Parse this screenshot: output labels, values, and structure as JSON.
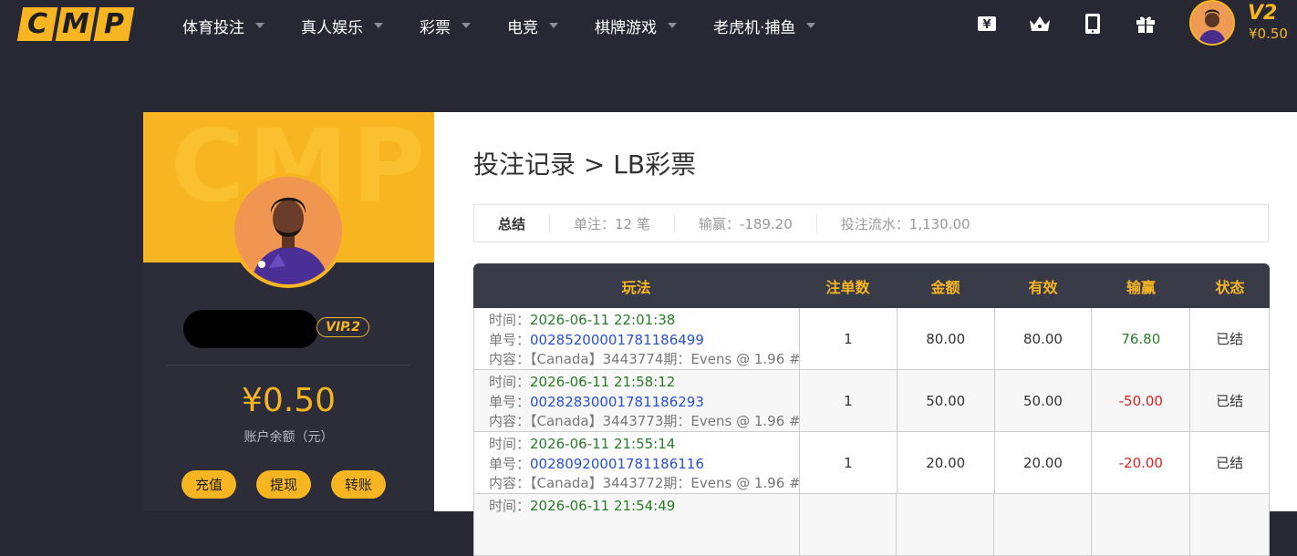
{
  "logo": {
    "letters": [
      "C",
      "M",
      "P"
    ]
  },
  "nav": [
    {
      "label": "体育投注"
    },
    {
      "label": "真人娱乐"
    },
    {
      "label": "彩票"
    },
    {
      "label": "电竞"
    },
    {
      "label": "棋牌游戏"
    },
    {
      "label": "老虎机·捕鱼"
    }
  ],
  "header_icons": [
    "yen-card-icon",
    "crown-icon",
    "tablet-icon",
    "gift-icon"
  ],
  "user": {
    "vip_level": "V2",
    "balance_small": "¥0.50",
    "vip_badge": "VIP.2",
    "balance": "¥0.50",
    "balance_label": "账户余额（元）",
    "actions": [
      "充值",
      "提现",
      "转账"
    ]
  },
  "banner_watermark": "CMP",
  "page": {
    "title": "投注记录 > LB彩票"
  },
  "summary": {
    "label": "总结",
    "bets": "单注：12 笔",
    "winloss": "输赢：-189.20",
    "turnover": "投注流水：1,130.00"
  },
  "table": {
    "headers": [
      "玩法",
      "注单数",
      "金额",
      "有效",
      "输赢",
      "状态"
    ],
    "field_labels": {
      "time": "时间：",
      "order": "单号：",
      "content": "内容："
    },
    "rows": [
      {
        "time": "2026-06-11 22:01:38",
        "order": "00285200001781186499",
        "content": "【Canada】3443774期：Evens @ 1.96 #",
        "count": "1",
        "amount": "80.00",
        "valid": "80.00",
        "winloss": "76.80",
        "status": "已结"
      },
      {
        "time": "2026-06-11 21:58:12",
        "order": "00282830001781186293",
        "content": "【Canada】3443773期：Evens @ 1.96 #",
        "count": "1",
        "amount": "50.00",
        "valid": "50.00",
        "winloss": "-50.00",
        "status": "已结"
      },
      {
        "time": "2026-06-11 21:55:14",
        "order": "00280920001781186116",
        "content": "【Canada】3443772期：Evens @ 1.96 #",
        "count": "1",
        "amount": "20.00",
        "valid": "20.00",
        "winloss": "-20.00",
        "status": "已结"
      },
      {
        "time": "2026-06-11 21:54:49",
        "order": "",
        "content": "",
        "count": "",
        "amount": "",
        "valid": "",
        "winloss": "",
        "status": ""
      }
    ]
  },
  "colors": {
    "accent": "#f7b621",
    "header_bg": "#272834",
    "positive": "#2a7a2a",
    "negative": "#e02020",
    "link": "#2a4fd0"
  }
}
